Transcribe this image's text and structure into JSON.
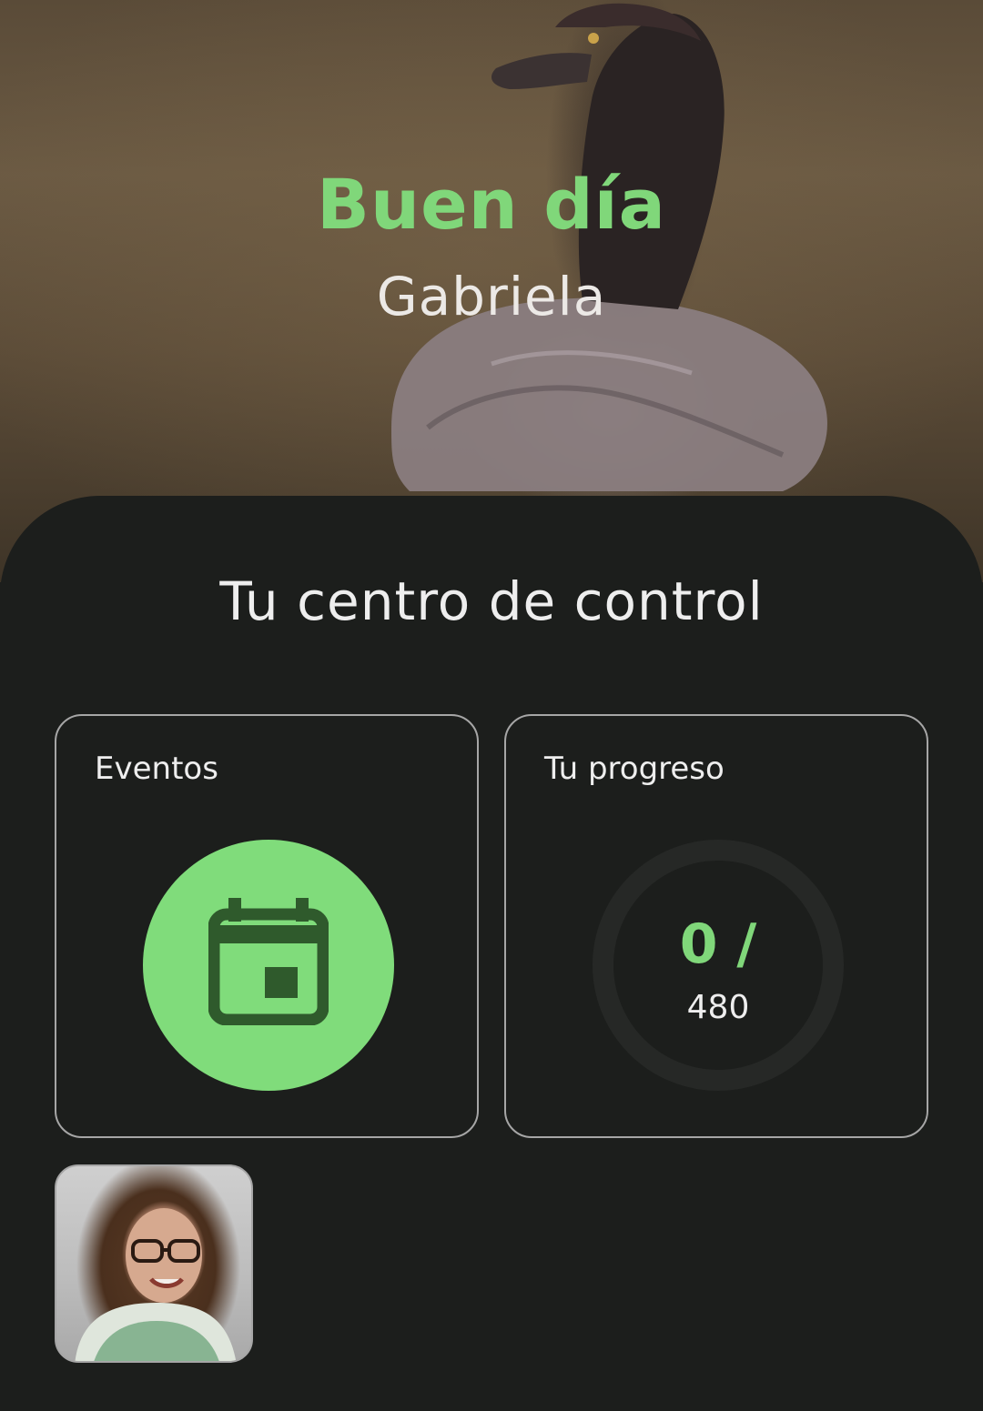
{
  "hero": {
    "greeting": "Buen día",
    "user_name": "Gabriela"
  },
  "dashboard": {
    "title": "Tu centro de control",
    "events_card": {
      "label": "Eventos",
      "icon": "calendar-icon"
    },
    "progress_card": {
      "label": "Tu progreso",
      "current": "0 /",
      "total": "480"
    }
  },
  "profile": {
    "avatar": "user-avatar-photo"
  },
  "colors": {
    "accent_green": "#80d77a",
    "icon_dark_green": "#2f5a2c",
    "background": "#1c1e1c",
    "card_border": "#a6a6a6"
  }
}
